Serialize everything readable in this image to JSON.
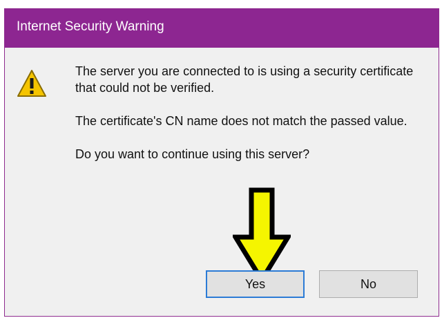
{
  "window": {
    "title": "Internet Security Warning",
    "accent_color": "#8d2691"
  },
  "icon": {
    "name": "warning-icon",
    "color": "#f5c400"
  },
  "message": {
    "line1": "The server you are connected to is using a security certificate that could not be verified.",
    "line2": "The certificate's CN name does not match the passed value.",
    "line3": "Do you want to continue using this server?"
  },
  "overlay": {
    "arrow_icon": "down-arrow-icon",
    "arrow_color": "#f5f500"
  },
  "buttons": {
    "yes_label": "Yes",
    "no_label": "No"
  }
}
